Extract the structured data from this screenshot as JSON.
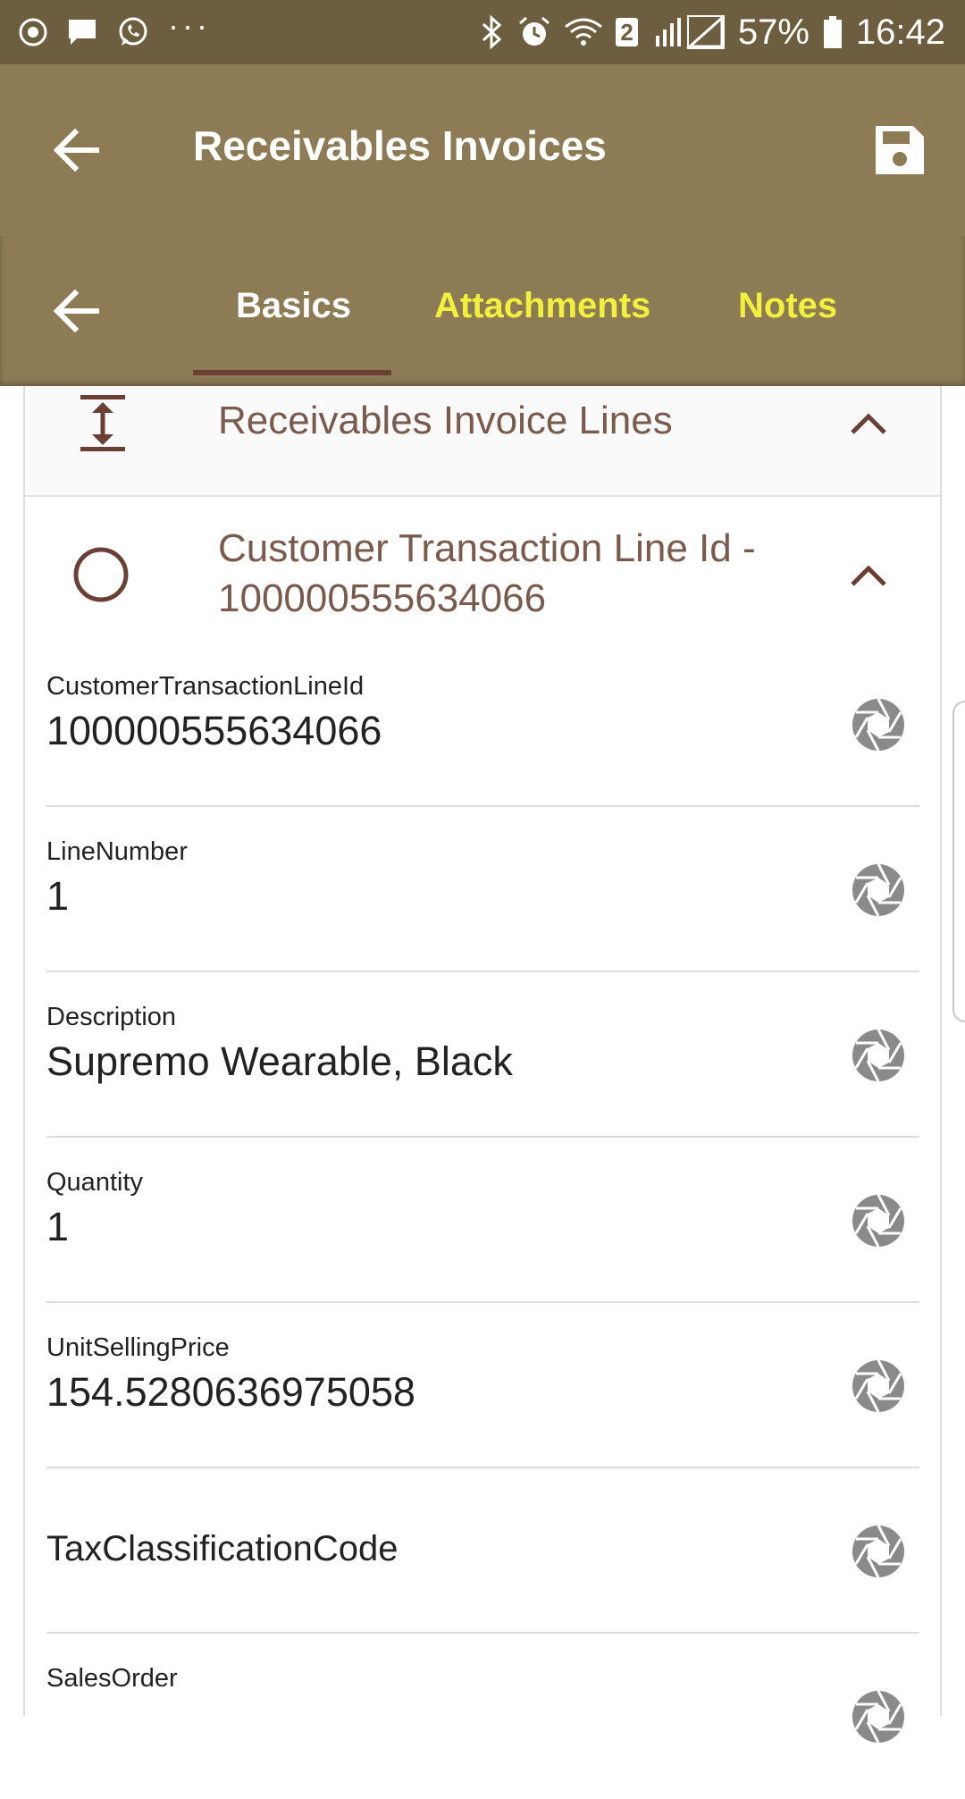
{
  "status_bar": {
    "battery": "57%",
    "time": "16:42",
    "sim_badge": "2",
    "overflow": "···",
    "icons": [
      "play-circle-icon",
      "message-icon",
      "whatsapp-icon",
      "bluetooth-icon",
      "alarm-icon",
      "wifi-icon",
      "signal-icon",
      "battery-icon"
    ]
  },
  "app_bar": {
    "title": "Receivables Invoices",
    "back_icon": "arrow-back-icon",
    "save_icon": "save-icon"
  },
  "tabs": {
    "items": [
      {
        "label": "Basics",
        "active": true
      },
      {
        "label": "Attachments",
        "active": false
      },
      {
        "label": "Notes",
        "active": false
      }
    ]
  },
  "sections": {
    "lines_header": "Receivables Invoice Lines",
    "line_header": "Customer Transaction Line Id - 100000555634066"
  },
  "fields": [
    {
      "label": "CustomerTransactionLineId",
      "value": "100000555634066"
    },
    {
      "label": "LineNumber",
      "value": "1"
    },
    {
      "label": "Description",
      "value": "Supremo Wearable, Black"
    },
    {
      "label": "Quantity",
      "value": "1"
    },
    {
      "label": "UnitSellingPrice",
      "value": "154.5280636975058"
    },
    {
      "label": "",
      "value": "TaxClassificationCode"
    },
    {
      "label": "SalesOrder",
      "value": ""
    }
  ],
  "colors": {
    "status_bar": "#6c5e3e",
    "app_bar": "#8c7b54",
    "tab_active_text": "#ffffff",
    "tab_inactive_text": "#f1f03c",
    "tab_indicator": "#6b3f33",
    "section_text": "#7a5a4d",
    "aperture_icon": "#8a8a8a"
  }
}
